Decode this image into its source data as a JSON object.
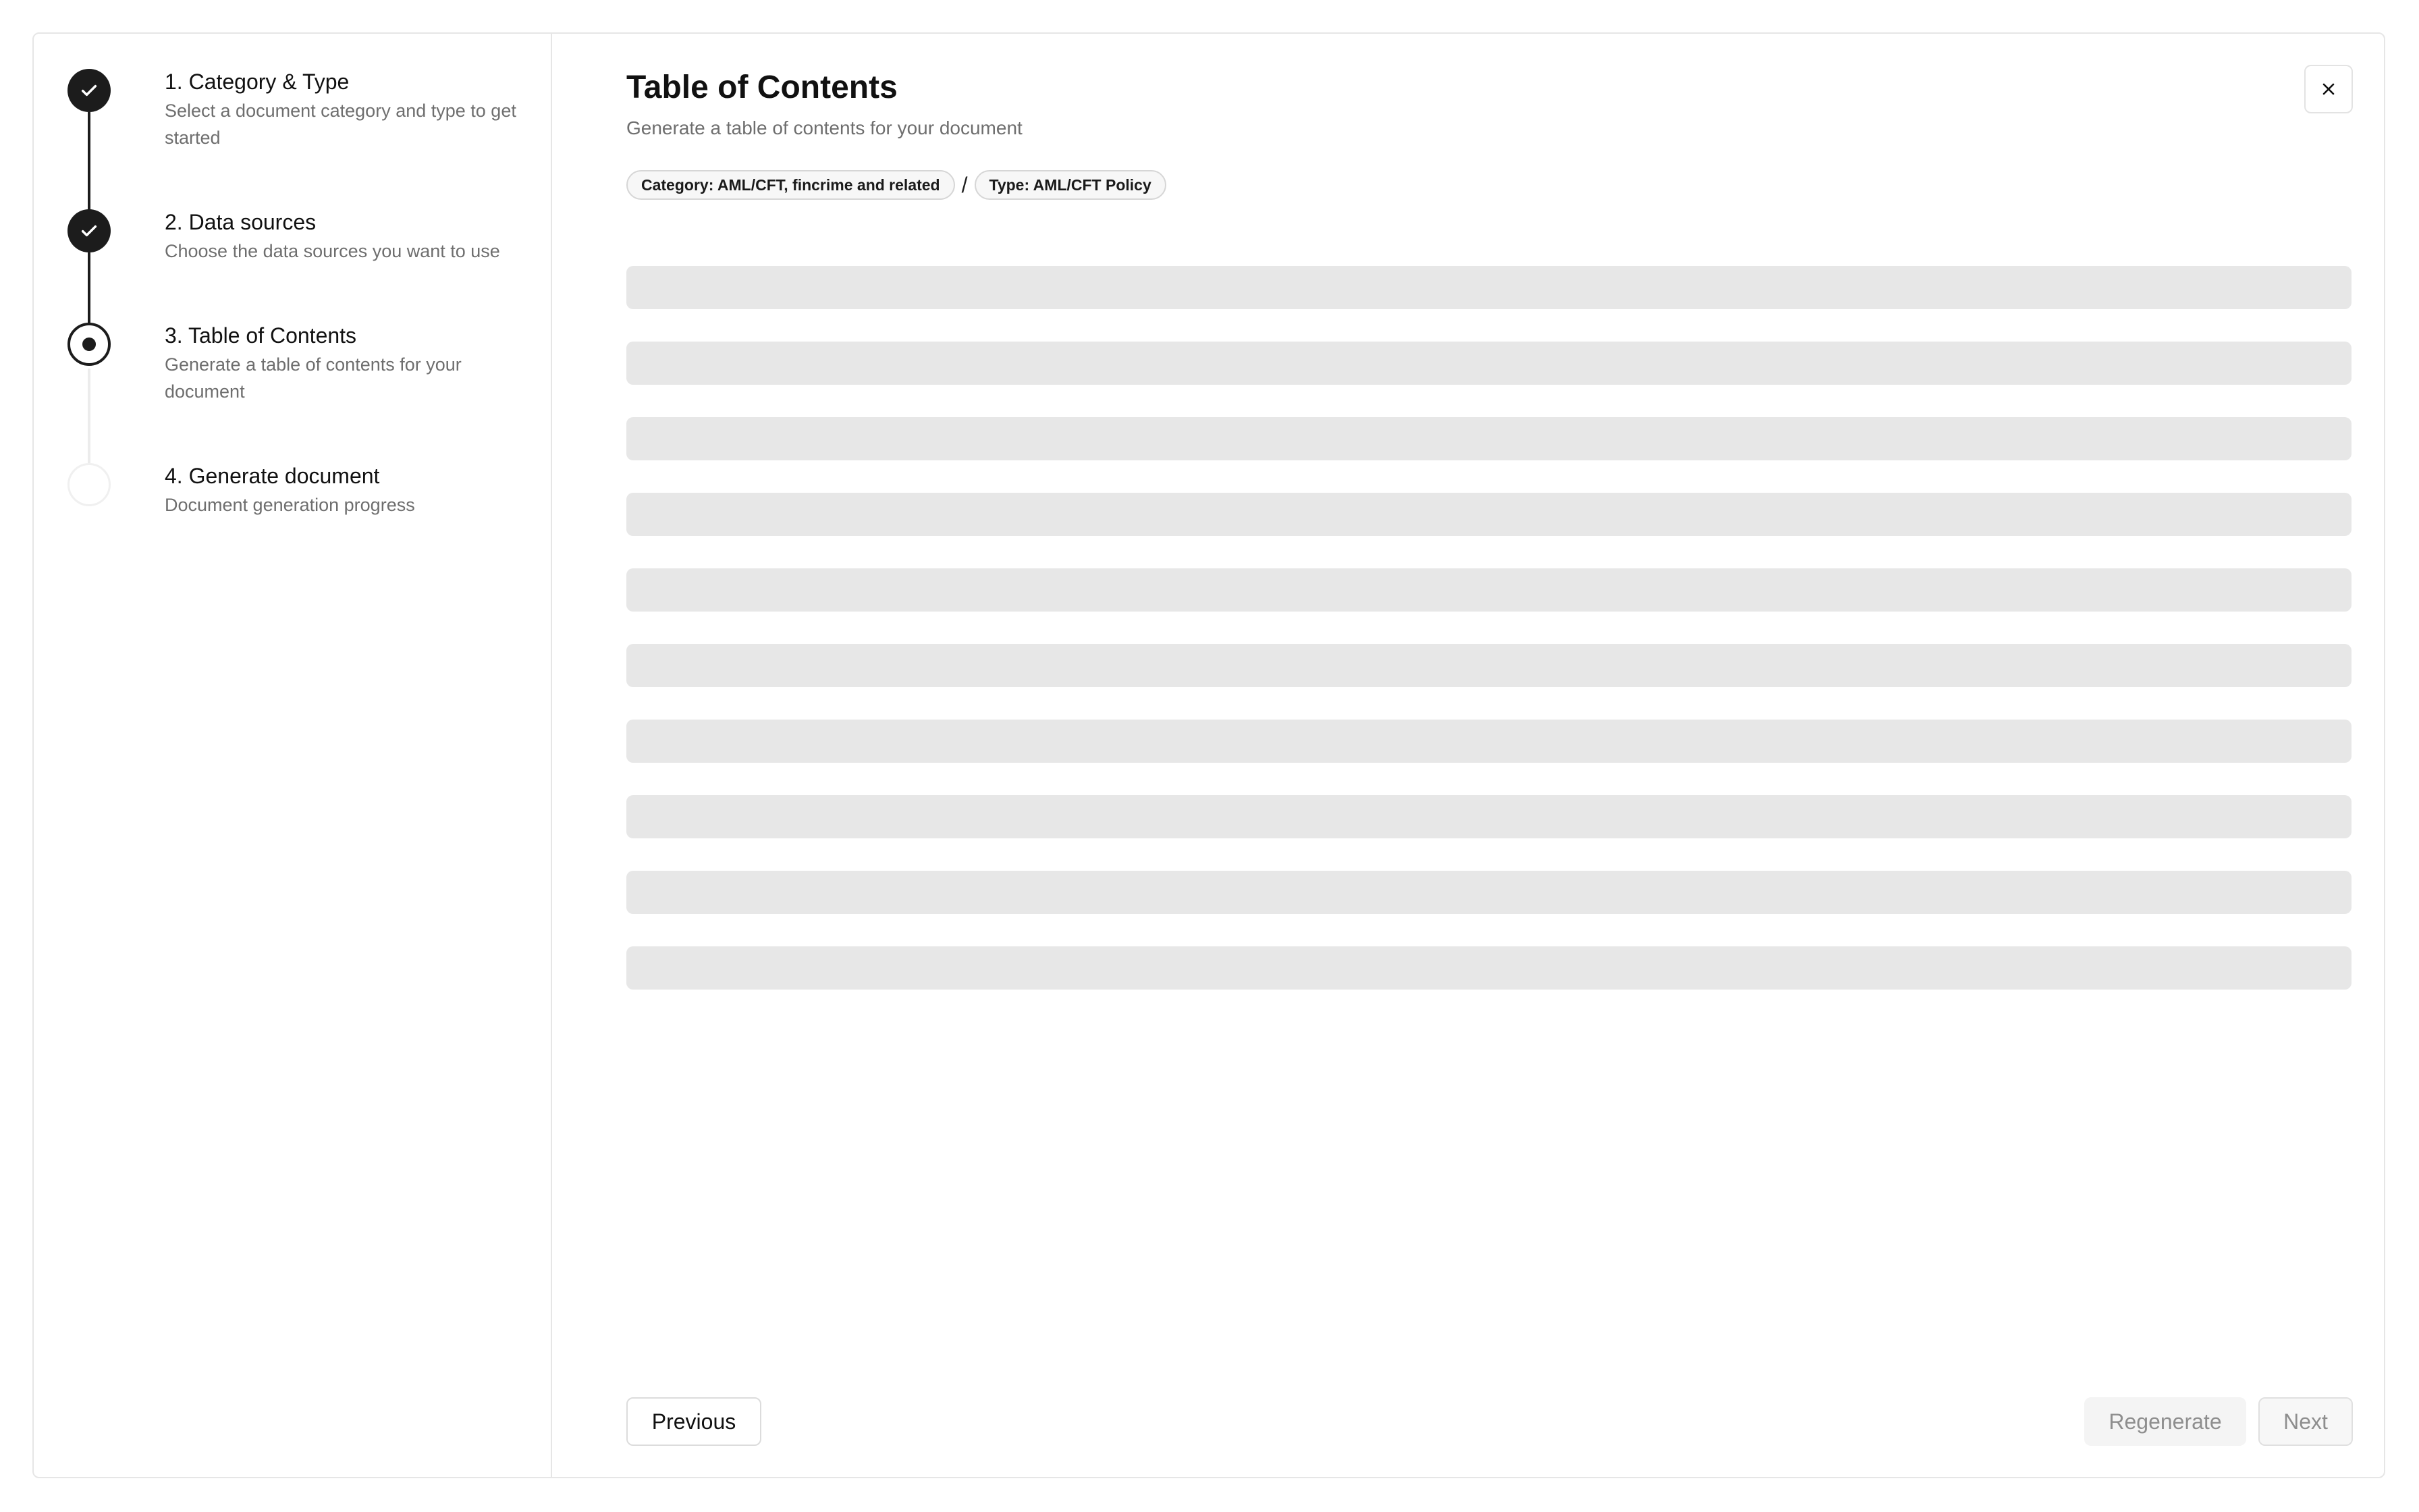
{
  "steps": [
    {
      "title": "1. Category & Type",
      "description": "Select a document category and type to get started",
      "status": "completed"
    },
    {
      "title": "2. Data sources",
      "description": "Choose the data sources you want to use",
      "status": "completed"
    },
    {
      "title": "3. Table of Contents",
      "description": "Generate a table of contents for your document",
      "status": "current"
    },
    {
      "title": "4. Generate document",
      "description": "Document generation progress",
      "status": "pending"
    }
  ],
  "header": {
    "title": "Table of Contents",
    "subtitle": "Generate a table of contents for your document"
  },
  "tags": {
    "category": "Category: AML/CFT, fincrime and related",
    "separator": "/",
    "type": "Type: AML/CFT Policy"
  },
  "icons": {
    "completed": "check-icon",
    "current": "dot-icon",
    "close": "close-icon"
  },
  "skeleton_rows": 10,
  "footer": {
    "previous_label": "Previous",
    "regenerate_label": "Regenerate",
    "next_label": "Next"
  },
  "colors": {
    "primary": "#1c1c1c",
    "muted_text": "#6e6e6e",
    "skeleton": "#e7e7e7",
    "border": "#e6e6e6"
  }
}
